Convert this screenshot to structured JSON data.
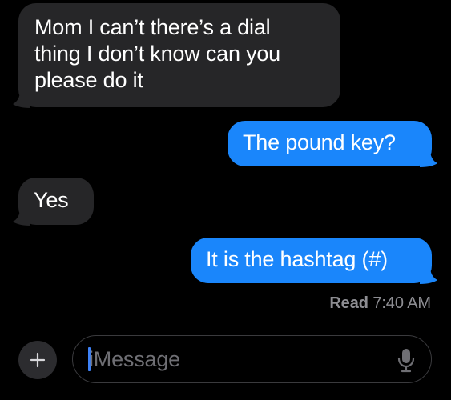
{
  "conversation": {
    "messages": [
      {
        "direction": "incoming",
        "lines": [
          "Mom I can’t there’s a dial",
          "thing I don’t know can you",
          "please do it"
        ]
      },
      {
        "direction": "outgoing",
        "text": "The pound key?"
      },
      {
        "direction": "incoming",
        "text": "Yes"
      },
      {
        "direction": "outgoing",
        "text": "It is the hashtag (#)"
      }
    ],
    "receipt": {
      "status": "Read",
      "time": "7:40 AM"
    }
  },
  "composer": {
    "placeholder": "iMessage",
    "add_icon": "plus-icon",
    "mic_icon": "microphone-icon"
  },
  "colors": {
    "background": "#000000",
    "incoming_bubble": "#262628",
    "outgoing_bubble": "#1a86fb",
    "text": "#ffffff",
    "muted": "#8d8d92"
  }
}
